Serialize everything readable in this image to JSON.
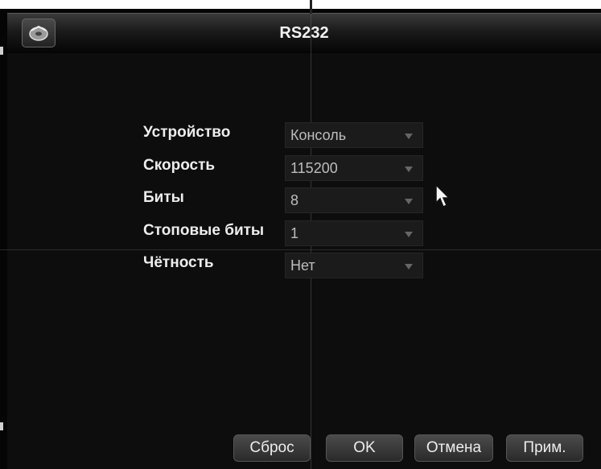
{
  "window": {
    "title": "RS232",
    "logo_icon": "disk-logo-icon"
  },
  "form": {
    "rows": [
      {
        "label": "Устройство",
        "value": "Консоль"
      },
      {
        "label": "Скорость",
        "value": "115200"
      },
      {
        "label": "Биты",
        "value": "8"
      },
      {
        "label": "Стоповые биты",
        "value": "1"
      },
      {
        "label": "Чётность",
        "value": "Нет"
      }
    ]
  },
  "buttons": {
    "reset": "Сброс",
    "ok": "OK",
    "cancel": "Отмена",
    "apply": "Прим."
  },
  "colors": {
    "background": "#0d0d0d",
    "text": "#ededed",
    "field_bg": "#1b1b1b"
  }
}
